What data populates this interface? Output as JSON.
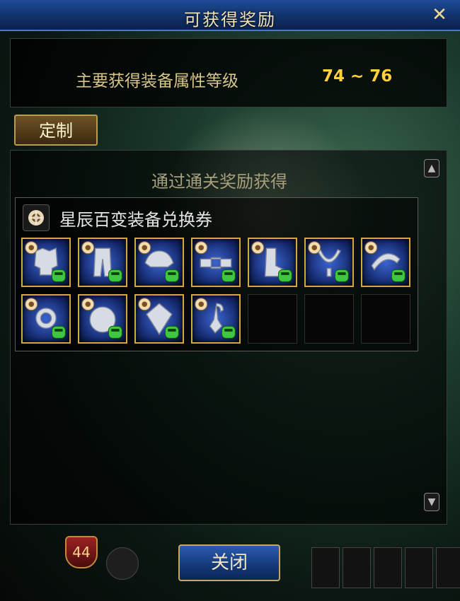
{
  "window": {
    "title": "可获得奖励",
    "close_glyph": "✕"
  },
  "attribute": {
    "label": "主要获得装备属性等级",
    "range": "74 ~ 76"
  },
  "custom_button": {
    "label": "定制"
  },
  "rewards": {
    "section_title": "通过通关奖励获得",
    "item_name": "星辰百变装备兑换券",
    "items": [
      {
        "icon": "coat-armor-icon"
      },
      {
        "icon": "pants-armor-icon"
      },
      {
        "icon": "shoulder-armor-icon"
      },
      {
        "icon": "belt-armor-icon"
      },
      {
        "icon": "shoes-armor-icon"
      },
      {
        "icon": "necklace-icon"
      },
      {
        "icon": "bracelet-icon"
      },
      {
        "icon": "ring-icon"
      },
      {
        "icon": "subequip-icon"
      },
      {
        "icon": "magic-stone-icon"
      },
      {
        "icon": "earring-icon"
      }
    ],
    "empty_slots": 3
  },
  "close_button": {
    "label": "关闭"
  },
  "hud": {
    "level_badge": "44"
  },
  "colors": {
    "title_bar": "#102f66",
    "attr_label": "#d8c58a",
    "attr_range": "#ffd23c",
    "slot_border": "#d8a640",
    "button_border": "#c6a75c"
  }
}
